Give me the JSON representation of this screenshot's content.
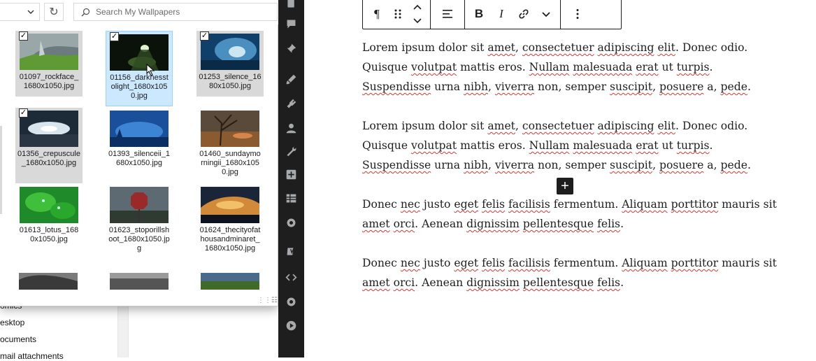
{
  "explorer_bg": {
    "nav_items": [
      "omics",
      "esktop",
      "ocuments",
      "mail attachments"
    ]
  },
  "picker": {
    "search": {
      "placeholder": "Search My Wallpapers"
    },
    "refresh_icon": "refresh-icon",
    "files": [
      {
        "name": "01097_rockface_1680x1050.jpg",
        "checked": true,
        "state": "selected"
      },
      {
        "name": "01156_darknesstolight_1680x1050.jpg",
        "checked": true,
        "state": "hover"
      },
      {
        "name": "01253_silence_1680x1050.jpg",
        "checked": true,
        "state": "selected"
      },
      {
        "name": "01356_crepuscule_1680x1050.jpg",
        "checked": true,
        "state": "selected"
      },
      {
        "name": "01393_silenceii_1680x1050.jpg",
        "checked": false,
        "state": "none"
      },
      {
        "name": "01460_sundaymorningii_1680x1050.jpg",
        "checked": false,
        "state": "none"
      },
      {
        "name": "01613_lotus_1680x1050.jpg",
        "checked": false,
        "state": "none"
      },
      {
        "name": "01623_stoporillshoot_1680x1050.jpg",
        "checked": false,
        "state": "none"
      },
      {
        "name": "01624_thecityofathousandminaret_1680x1050.jpg",
        "checked": false,
        "state": "none"
      }
    ]
  },
  "admin_bar": {
    "icons": [
      "pages-icon",
      "comments-icon",
      "pin-icon",
      "brush-icon",
      "plugins-icon",
      "users-icon",
      "tools-icon",
      "media-plus-icon",
      "table-icon",
      "settings-icon",
      "yoast-icon",
      "code-icon",
      "gear-icon",
      "play-icon"
    ]
  },
  "toolbar": {
    "paragraph_glyph": "¶",
    "bold_label": "B",
    "italic_label": "I"
  },
  "paragraphs": [
    "Lorem ipsum dolor sit amet, consectetuer adipiscing elit. Donec odio. Quisque volutpat mattis eros. Nullam malesuada erat ut turpis. Suspendisse urna nibh, viverra non, semper suscipit, posuere a, pede.",
    "Lorem ipsum dolor sit amet, consectetuer adipiscing elit. Donec odio. Quisque volutpat mattis eros. Nullam malesuada erat ut turpis. Suspendisse urna nibh, viverra non, semper suscipit, posuere a, pede.",
    "Donec nec justo eget felis facilisis fermentum. Aliquam porttitor mauris sit amet orci. Aenean dignissim pellentesque felis.",
    "Donec nec justo eget felis facilisis fermentum. Aliquam porttitor mauris sit amet orci. Aenean dignissim pellentesque felis."
  ],
  "spellcheck_words": [
    "amet",
    "consectetuer",
    "adipiscing",
    "elit",
    "volutpat",
    "Nullam",
    "malesuada",
    "erat",
    "turpis",
    "Suspendisse",
    "nibh",
    "viverra",
    "suscipit",
    "posuere",
    "pede",
    "nec",
    "eget",
    "felis",
    "facilisis",
    "Aliquam",
    "porttitor",
    "orci",
    "dignissim",
    "pellentesque"
  ],
  "inserter": {
    "label": "+"
  }
}
